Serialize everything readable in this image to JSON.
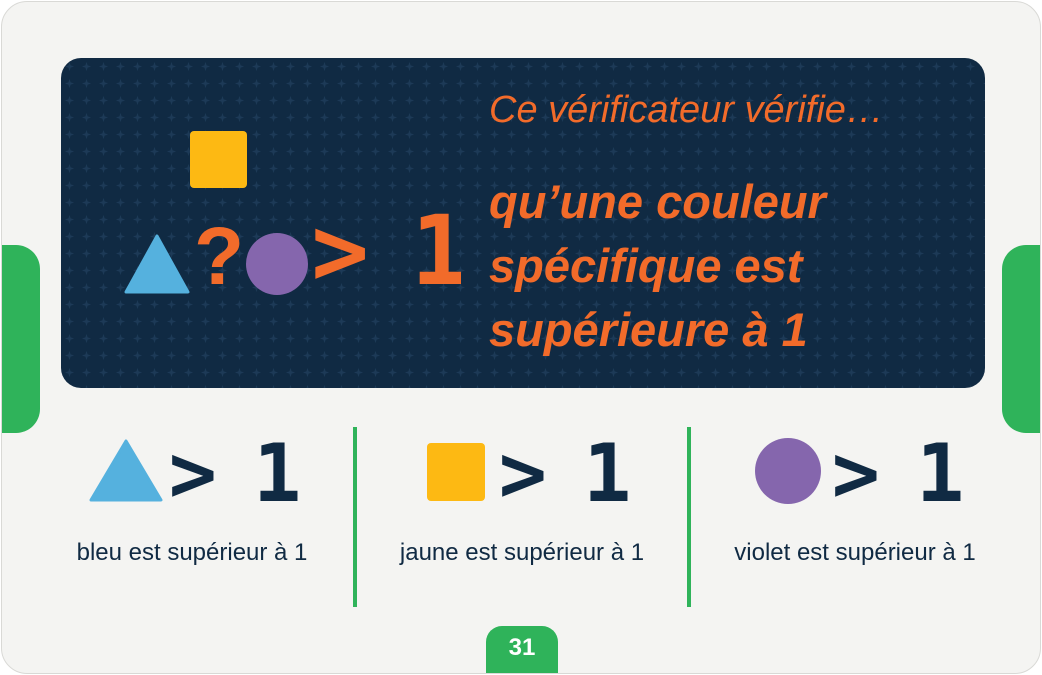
{
  "colors": {
    "blue": "#55b1de",
    "yellow": "#fdb913",
    "purple": "#8566ad",
    "orange": "#f26b2a",
    "navy": "#102a43",
    "green": "#2fb35a"
  },
  "header": {
    "title": "Ce vérificateur vérifie…",
    "subtitle": "qu’une couleur spécifique est supérieure à 1",
    "question_mark": "?",
    "comparison": "> 1",
    "icons": [
      "yellow-square-icon",
      "blue-triangle-icon",
      "purple-circle-icon"
    ]
  },
  "options": [
    {
      "icon": "blue-triangle-icon",
      "comparison": "> 1",
      "label": "bleu est supérieur à 1"
    },
    {
      "icon": "yellow-square-icon",
      "comparison": "> 1",
      "label": "jaune est supérieur à 1"
    },
    {
      "icon": "purple-circle-icon",
      "comparison": "> 1",
      "label": "violet est supérieur à 1"
    }
  ],
  "page_number": "31"
}
